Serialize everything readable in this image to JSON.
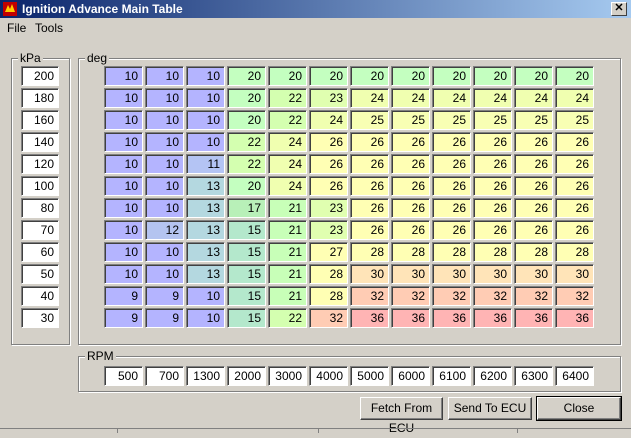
{
  "window": {
    "title": "Ignition Advance Main Table",
    "close_glyph": "✕"
  },
  "menu": {
    "items": [
      "File",
      "Tools"
    ]
  },
  "kpa": {
    "label": "kPa",
    "values": [
      200,
      180,
      160,
      140,
      120,
      100,
      80,
      70,
      60,
      50,
      40,
      30
    ]
  },
  "table": {
    "label": "deg",
    "rows": [
      [
        10,
        10,
        10,
        20,
        20,
        20,
        20,
        20,
        20,
        20,
        20,
        20
      ],
      [
        10,
        10,
        10,
        20,
        22,
        23,
        24,
        24,
        24,
        24,
        24,
        24
      ],
      [
        10,
        10,
        10,
        20,
        22,
        24,
        25,
        25,
        25,
        25,
        25,
        25
      ],
      [
        10,
        10,
        10,
        22,
        24,
        26,
        26,
        26,
        26,
        26,
        26,
        26
      ],
      [
        10,
        10,
        11,
        22,
        24,
        26,
        26,
        26,
        26,
        26,
        26,
        26
      ],
      [
        10,
        10,
        13,
        20,
        24,
        26,
        26,
        26,
        26,
        26,
        26,
        26
      ],
      [
        10,
        10,
        13,
        17,
        21,
        23,
        26,
        26,
        26,
        26,
        26,
        26
      ],
      [
        10,
        12,
        13,
        15,
        21,
        23,
        26,
        26,
        26,
        26,
        26,
        26
      ],
      [
        10,
        10,
        13,
        15,
        21,
        27,
        28,
        28,
        28,
        28,
        28,
        28
      ],
      [
        10,
        10,
        13,
        15,
        21,
        28,
        30,
        30,
        30,
        30,
        30,
        30
      ],
      [
        9,
        9,
        10,
        15,
        21,
        28,
        32,
        32,
        32,
        32,
        32,
        32
      ],
      [
        9,
        9,
        10,
        15,
        22,
        32,
        36,
        36,
        36,
        36,
        36,
        36
      ]
    ]
  },
  "rpm": {
    "label": "RPM",
    "values": [
      500,
      700,
      1300,
      2000,
      3000,
      4000,
      5000,
      6000,
      6100,
      6200,
      6300,
      6400
    ]
  },
  "buttons": {
    "fetch": "Fetch From ECU",
    "send": "Send To ECU",
    "close": "Close"
  },
  "colors": {
    "background": "#d4d0c8",
    "title_start": "#0a246a",
    "title_end": "#a6caf0",
    "deg_scale": {
      "9": "#b4b4ff",
      "10": "#b4b4ff",
      "11": "#b4c4f4",
      "12": "#b4c4f0",
      "13": "#b4d8e0",
      "15": "#b4e8cc",
      "17": "#b8f0b8",
      "20": "#c4ffc0",
      "21": "#c8ffb8",
      "22": "#d4ffb0",
      "23": "#e0ffb0",
      "24": "#f0ffb0",
      "25": "#f8ffb4",
      "26": "#ffffb4",
      "27": "#ffffb4",
      "28": "#ffffb4",
      "30": "#ffe4b8",
      "32": "#ffccb4",
      "36": "#ffb4b4"
    }
  }
}
